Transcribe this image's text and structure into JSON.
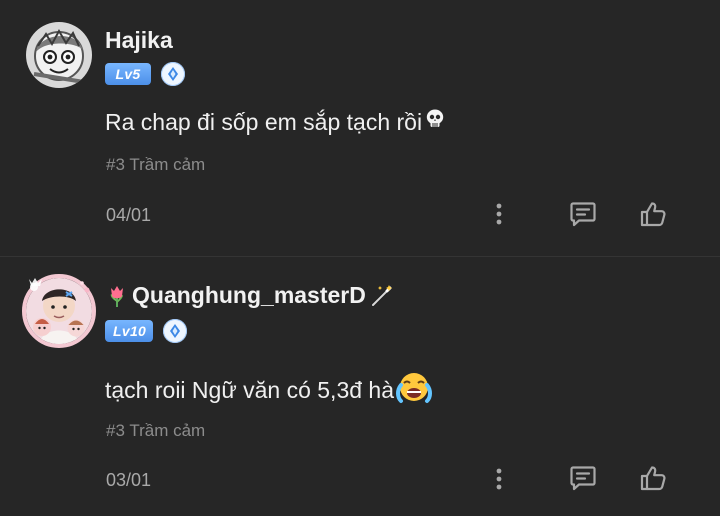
{
  "comments": [
    {
      "username": "Hajika",
      "level": "Lv5",
      "message": "Ra chap đi sốp em sắp tạch rồi",
      "message_emoji": "skull-emoji",
      "tag": "#3 Trầm cảm",
      "date": "04/01"
    },
    {
      "username": "Quanghung_masterD",
      "username_prefix_emoji": "tulip-emoji",
      "username_suffix_emoji": "magic-wand-emoji",
      "level": "Lv10",
      "message": "tạch roii Ngữ văn có 5,3đ hà",
      "message_emoji": "loudly-crying-face-emoji",
      "tag": "#3 Trầm cảm",
      "date": "03/01"
    }
  ],
  "colors": {
    "background": "#262626",
    "level_badge": "#5f9ff0",
    "muted_text": "#8c8c8c",
    "icon": "#a8a8a8"
  }
}
